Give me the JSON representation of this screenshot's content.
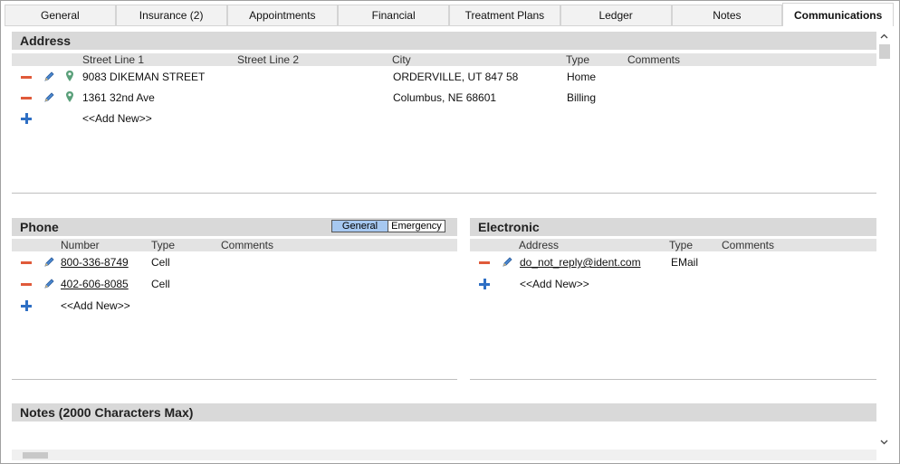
{
  "tabs": [
    {
      "label": "General"
    },
    {
      "label": "Insurance (2)"
    },
    {
      "label": "Appointments"
    },
    {
      "label": "Financial"
    },
    {
      "label": "Treatment Plans"
    },
    {
      "label": "Ledger"
    },
    {
      "label": "Notes"
    },
    {
      "label": "Communications"
    }
  ],
  "active_tab": "Communications",
  "address": {
    "title": "Address",
    "columns": {
      "street1": "Street Line 1",
      "street2": "Street Line 2",
      "city": "City",
      "type": "Type",
      "comments": "Comments"
    },
    "rows": [
      {
        "street1": "9083 DIKEMAN STREET",
        "street2": "",
        "city": "ORDERVILLE, UT 847 58",
        "type": "Home",
        "comments": ""
      },
      {
        "street1": "1361 32nd Ave",
        "street2": "",
        "city": "Columbus, NE 68601",
        "type": "Billing",
        "comments": ""
      }
    ],
    "add_new": "<<Add New>>"
  },
  "phone": {
    "title": "Phone",
    "toggle": {
      "general": "General",
      "emergency": "Emergency"
    },
    "columns": {
      "number": "Number",
      "type": "Type",
      "comments": "Comments"
    },
    "rows": [
      {
        "number": "800-336-8749",
        "type": "Cell",
        "comments": ""
      },
      {
        "number": "402-606-8085",
        "type": "Cell",
        "comments": ""
      }
    ],
    "add_new": "<<Add New>>"
  },
  "electronic": {
    "title": "Electronic",
    "columns": {
      "address": "Address",
      "type": "Type",
      "comments": "Comments"
    },
    "rows": [
      {
        "address": "do_not_reply@ident.com",
        "type": "EMail",
        "comments": ""
      }
    ],
    "add_new": "<<Add New>>"
  },
  "notes": {
    "title": "Notes (2000 Characters Max)"
  },
  "colors": {
    "accent_blue": "#a6c8f0",
    "minus_red": "#e05a3a",
    "plus_blue": "#2e6fc4",
    "link_blue": "#1a3fcf"
  },
  "icons": [
    "minus-icon",
    "pencil-icon",
    "map-pin-icon",
    "plus-icon",
    "chevron-up-icon",
    "chevron-down-icon"
  ]
}
